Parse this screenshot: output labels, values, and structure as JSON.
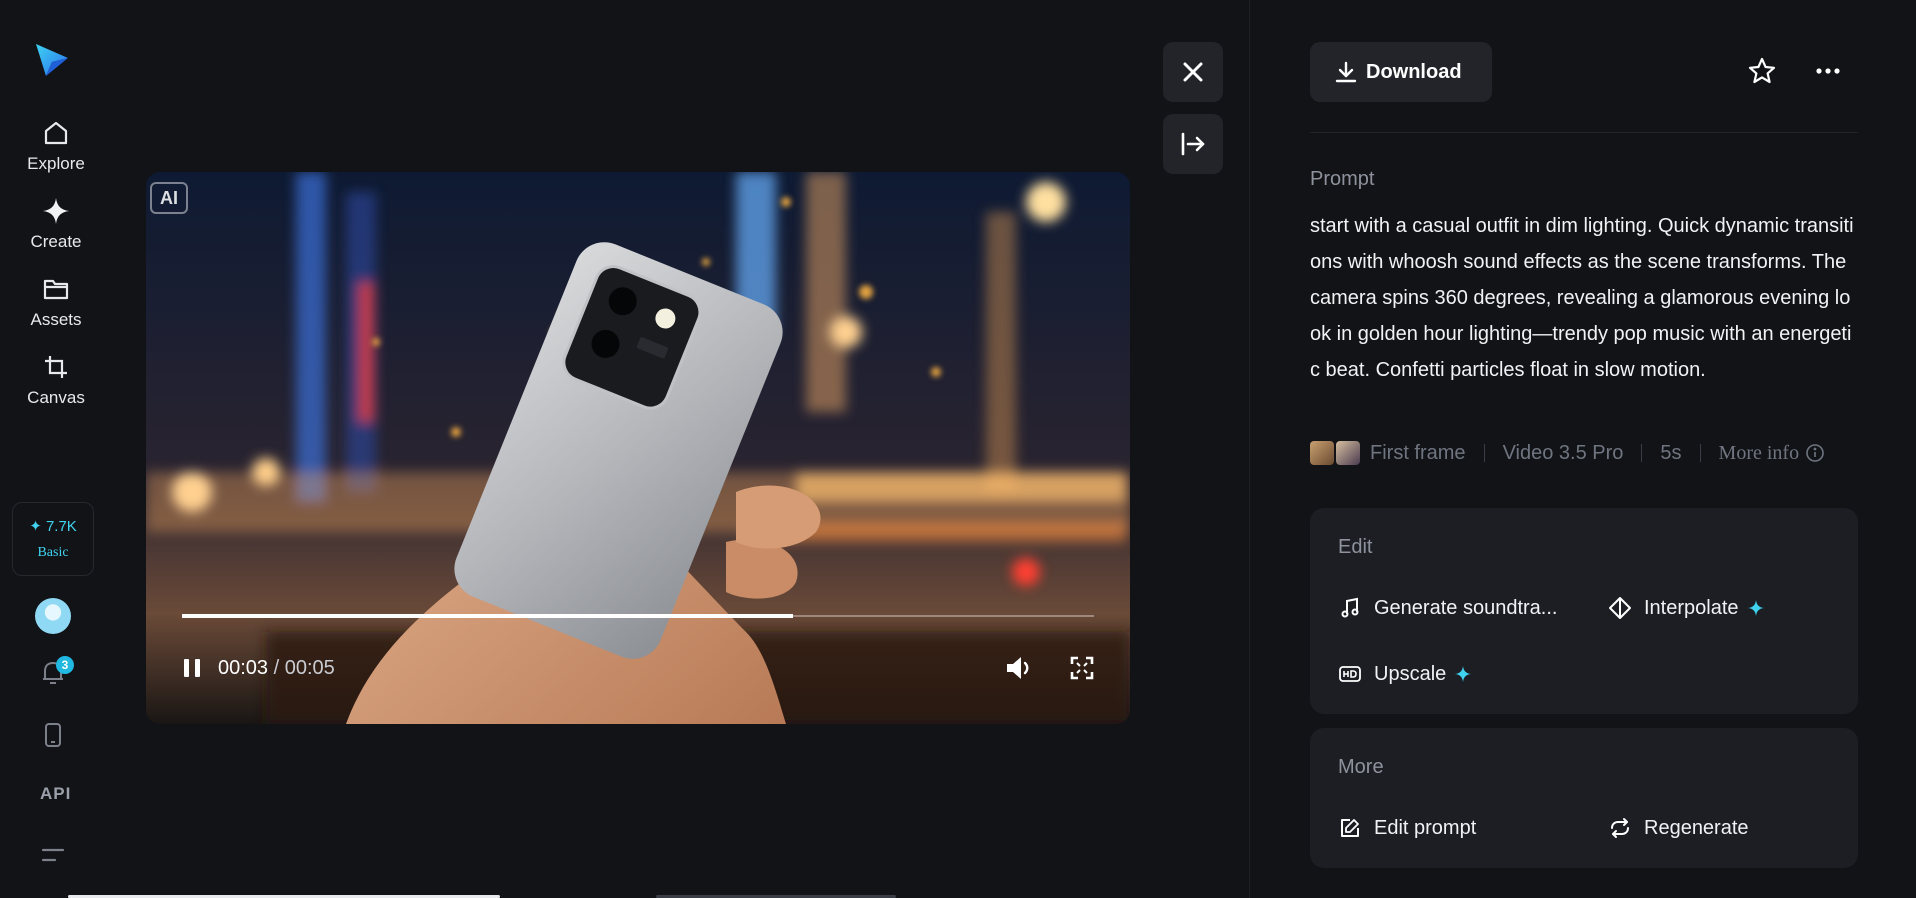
{
  "sidebar": {
    "items": [
      {
        "label": "Explore",
        "icon": "home-icon"
      },
      {
        "label": "Create",
        "icon": "sparkle-icon"
      },
      {
        "label": "Assets",
        "icon": "folder-icon"
      },
      {
        "label": "Canvas",
        "icon": "crop-icon"
      }
    ],
    "credits": {
      "amount": "✦ 7.7K",
      "tier": "Basic"
    },
    "notifications_badge": "3",
    "api_label": "API"
  },
  "player": {
    "ai_badge": "AI",
    "current_time": "00:03",
    "total_time": " / 00:05",
    "progress": 0.67
  },
  "details": {
    "download_label": "Download",
    "prompt_label": "Prompt",
    "prompt_text": "start with a casual outfit in dim lighting. Quick dynamic transitions with whoosh sound effects as the scene transforms. The camera spins 360 degrees, revealing a glamorous evening look in golden hour lighting—trendy pop music with an energetic beat. Confetti particles float in slow motion.",
    "meta": {
      "first_frame": "First frame",
      "model": "Video 3.5 Pro",
      "duration": "5s",
      "more_info": "More info"
    },
    "edit": {
      "title": "Edit",
      "actions": [
        "Generate soundtra...",
        "Interpolate",
        "Upscale"
      ]
    },
    "more": {
      "title": "More",
      "actions": [
        "Edit prompt",
        "Regenerate"
      ]
    }
  },
  "colors": {
    "background": "#121317",
    "card": "#1c1e24",
    "accent": "#3fd3f0"
  }
}
